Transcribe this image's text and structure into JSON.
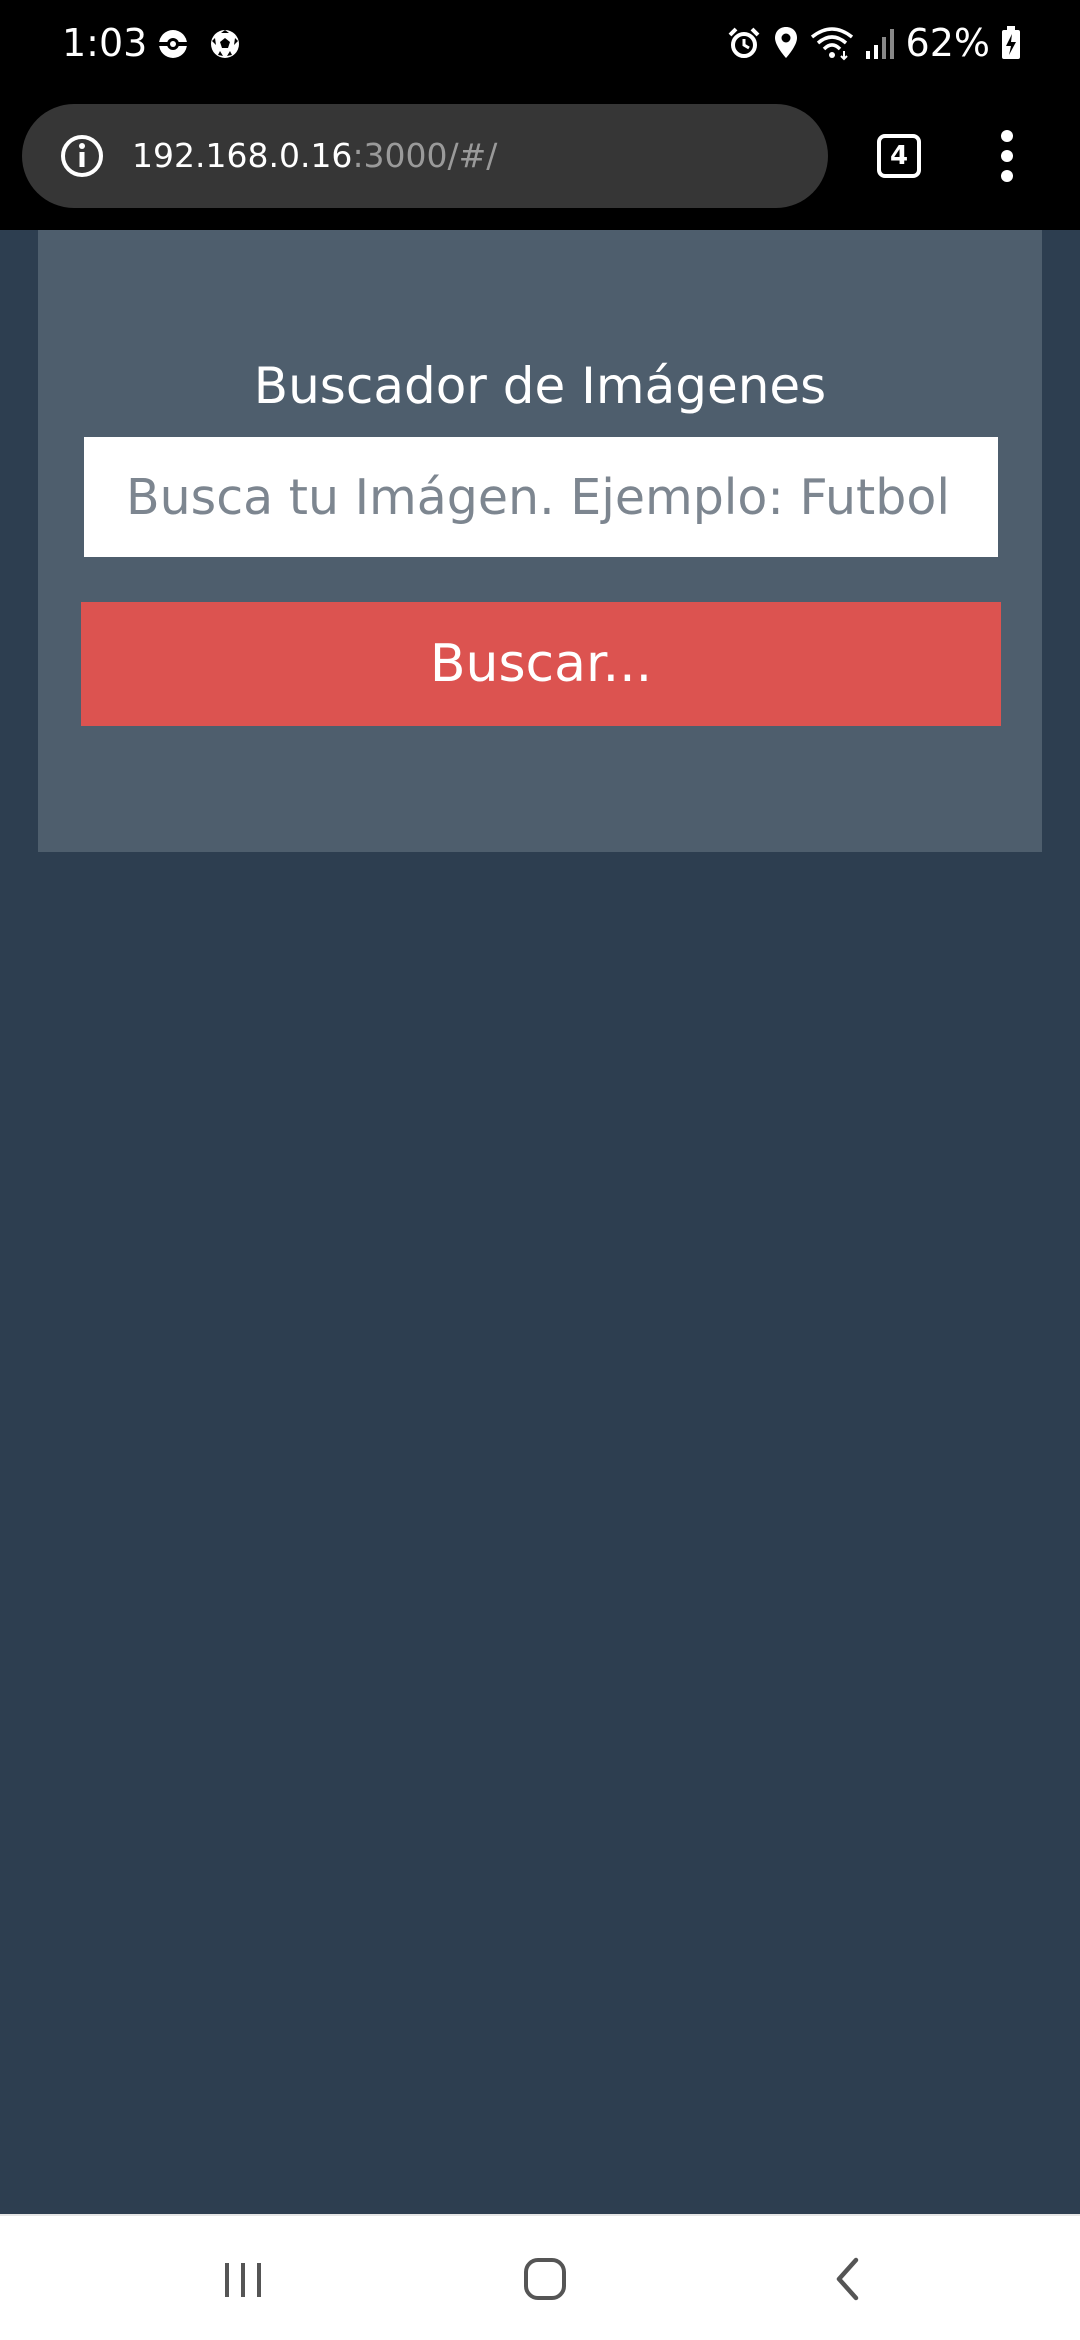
{
  "status_bar": {
    "time": "1:03",
    "battery_percent": "62%",
    "left_icons": [
      "pokeball-icon",
      "soccer-ball-icon"
    ],
    "right_icons": [
      "alarm-icon",
      "location-icon",
      "wifi-icon",
      "signal-icon",
      "battery-charging-icon"
    ]
  },
  "browser": {
    "url_host": "192.168.0.16",
    "url_path": ":3000/#/",
    "tab_count": "4",
    "info_icon": "info-icon",
    "menu_icon": "more-vert-icon"
  },
  "search": {
    "title": "Buscador de Imágenes",
    "placeholder": "Busca tu Imágen. Ejemplo: Futbol",
    "value": "",
    "button_label": "Buscar..."
  },
  "nav_bar": {
    "buttons": [
      "recent-apps-icon",
      "home-icon",
      "back-icon"
    ]
  },
  "colors": {
    "page_background": "#2d3e50",
    "card_background": "#4e5e6d",
    "button_accent": "#dc5350"
  }
}
